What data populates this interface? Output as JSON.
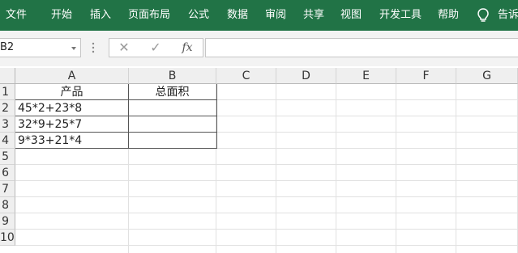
{
  "ribbon": {
    "tabs": [
      "文件",
      "开始",
      "插入",
      "页面布局",
      "公式",
      "数据",
      "审阅",
      "共享",
      "视图",
      "开发工具",
      "帮助"
    ],
    "tell_me": "告诉"
  },
  "formula_bar": {
    "name_box": "B2",
    "formula": ""
  },
  "grid": {
    "columns": [
      "A",
      "B",
      "C",
      "D",
      "E",
      "F",
      "G"
    ],
    "rows": [
      "1",
      "2",
      "3",
      "4",
      "5",
      "6",
      "7",
      "8",
      "9",
      "10"
    ],
    "cells": {
      "A1": "产品",
      "B1": "总面积",
      "A2": "45*2+23*8",
      "A3": "32*9+25*7",
      "A4": "9*33+21*4"
    }
  }
}
